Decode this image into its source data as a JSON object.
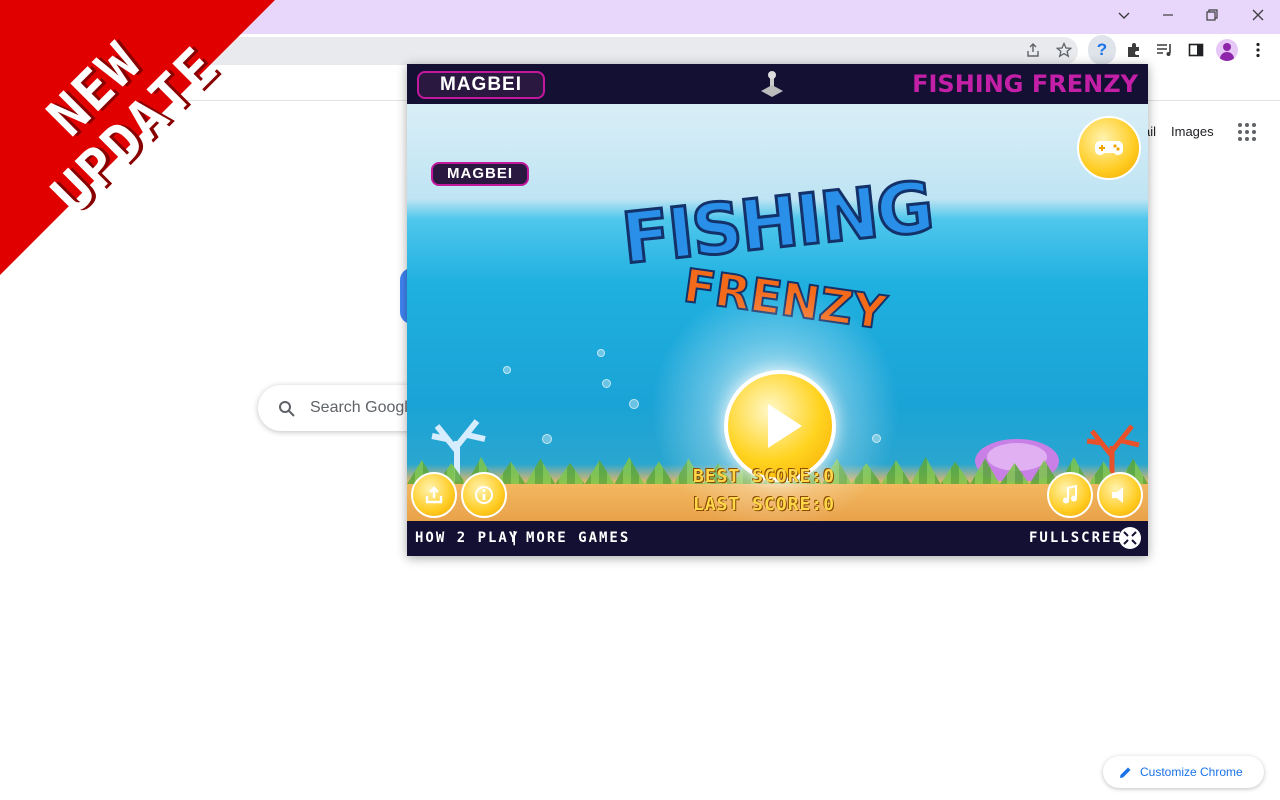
{
  "promo": {
    "line1": "NEW",
    "line2": "UPDATE"
  },
  "window_controls": {
    "dropdown": "chevron-down-icon",
    "minimize": "minimize-icon",
    "restore": "restore-icon",
    "close": "close-icon"
  },
  "toolbar_icons": [
    "share-icon",
    "star-icon",
    "help-extension-icon",
    "extensions-puzzle-icon",
    "reading-list-icon",
    "side-panel-icon",
    "profile-icon",
    "kebab-menu-icon"
  ],
  "ntp": {
    "links": {
      "gmail": "ail",
      "images": "Images"
    },
    "search_placeholder": "Search Google",
    "customize_label": "Customize Chrome"
  },
  "popup": {
    "brand": "MAGBEI",
    "header_title": "FISHING FRENZY",
    "logo_line1": "FISHING",
    "logo_line2": "FRENZY",
    "best_score": "BEST SCORE:0",
    "last_score": "LAST SCORE:0",
    "footer": {
      "how_to_play": "HOW 2 PLAY",
      "separator": "|",
      "more_games": "MORE GAMES",
      "fullscreen": "FULLSCREEN"
    }
  },
  "colors": {
    "titlebar": "#e9d7fb",
    "promo_red": "#e10000",
    "popup_bar": "#141033",
    "magenta": "#c41fa7",
    "link_blue": "#1a73e8"
  }
}
